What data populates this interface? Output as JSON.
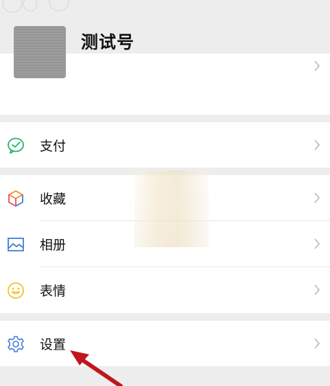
{
  "profile": {
    "nickname": "测试号"
  },
  "menu": {
    "pay": {
      "label": "支付",
      "icon": "wechat-pay-icon",
      "color": "#22b46b"
    },
    "favorites": {
      "label": "收藏",
      "icon": "cube-favorites-icon"
    },
    "album": {
      "label": "相册",
      "icon": "image-album-icon",
      "color": "#3e7cd8"
    },
    "stickers": {
      "label": "表情",
      "icon": "smiley-icon",
      "color": "#f0c22a"
    },
    "settings": {
      "label": "设置",
      "icon": "gear-icon",
      "color": "#3e7cd8"
    }
  },
  "colors": {
    "page_bg": "#ededed",
    "card_bg": "#ffffff",
    "chevron": "#b7b7b7",
    "annotation_arrow": "#c0161c"
  }
}
